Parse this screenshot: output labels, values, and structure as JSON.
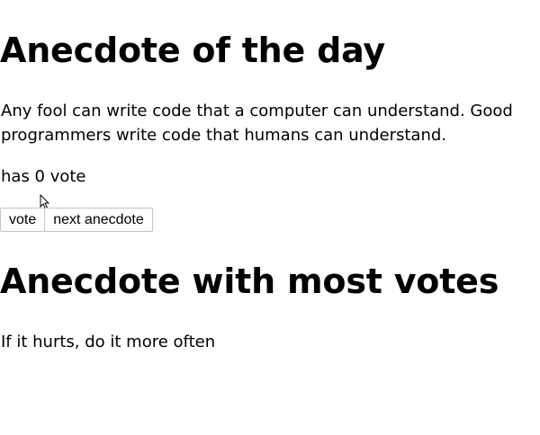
{
  "anecdote": {
    "heading": "Anecdote of the day",
    "text": "Any fool can write code that a computer can understand. Good programmers write code that humans can understand.",
    "votes_text": "has 0 vote"
  },
  "buttons": {
    "vote_label": "vote",
    "next_label": "next anecdote"
  },
  "most_votes": {
    "heading": "Anecdote with most votes",
    "text": "If it hurts, do it more often"
  },
  "icons": {
    "cursor": "mouse-pointer-icon"
  }
}
